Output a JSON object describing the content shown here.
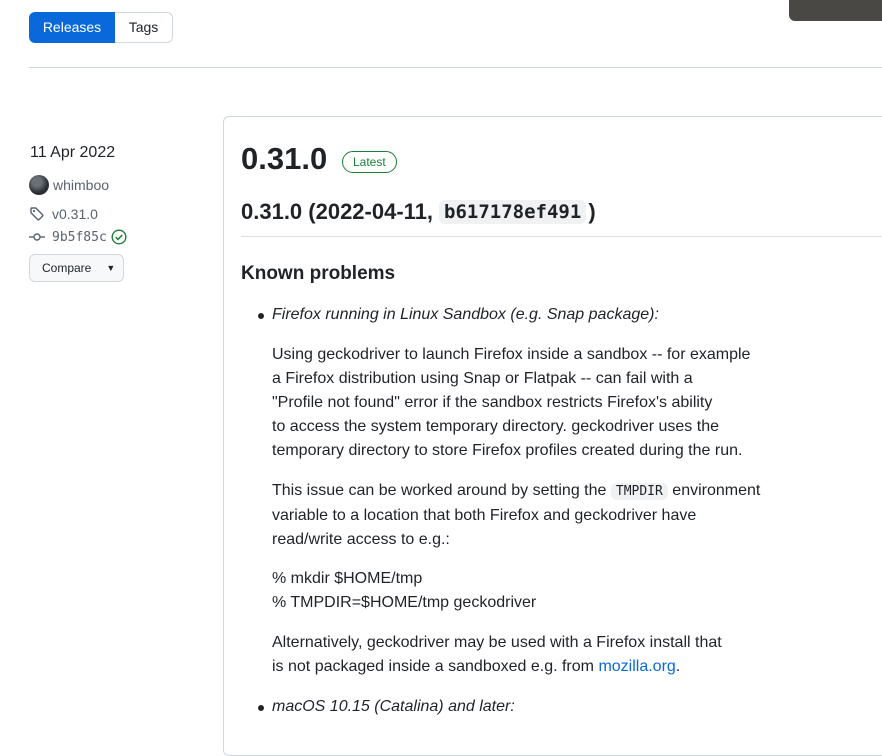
{
  "tabs": {
    "releases": "Releases",
    "tags": "Tags"
  },
  "release": {
    "date": "11 Apr 2022",
    "author": "whimboo",
    "tag": "v0.31.0",
    "commit": "9b5f85c",
    "compare_label": "Compare",
    "title": "0.31.0",
    "latest_badge": "Latest",
    "heading_prefix": "0.31.0 (2022-04-11,",
    "heading_hash": "b617178ef491",
    "heading_suffix": ")"
  },
  "notes": {
    "section_title": "Known problems",
    "item1_title": "Firefox running in Linux Sandbox (e.g. Snap package):",
    "para1": [
      "Using geckodriver to launch Firefox inside a sandbox -- for example",
      "a Firefox distribution using Snap or Flatpak -- can fail with a",
      "\"Profile not found\" error if the sandbox restricts Firefox's ability",
      "to access the system temporary directory. geckodriver uses the",
      "temporary directory to store Firefox profiles created during the run."
    ],
    "para2_a": "This issue can be worked around by setting the",
    "para2_code": "TMPDIR",
    "para2_b": "environment",
    "para2_line2": "variable to a location that both Firefox and geckodriver have",
    "para2_line3": "read/write access to e.g.:",
    "cmd1": "% mkdir $HOME/tmp",
    "cmd2": "% TMPDIR=$HOME/tmp geckodriver",
    "para4_line1": "Alternatively, geckodriver may be used with a Firefox install that",
    "para4_line2_a": "is not packaged inside a sandboxed e.g. from",
    "para4_link": "mozilla.org",
    "para4_line2_b": ".",
    "item2_title": "macOS 10.15 (Catalina) and later:"
  },
  "colors": {
    "accent": "#0969da",
    "success": "#1a7f37",
    "border": "#d0d7de"
  }
}
